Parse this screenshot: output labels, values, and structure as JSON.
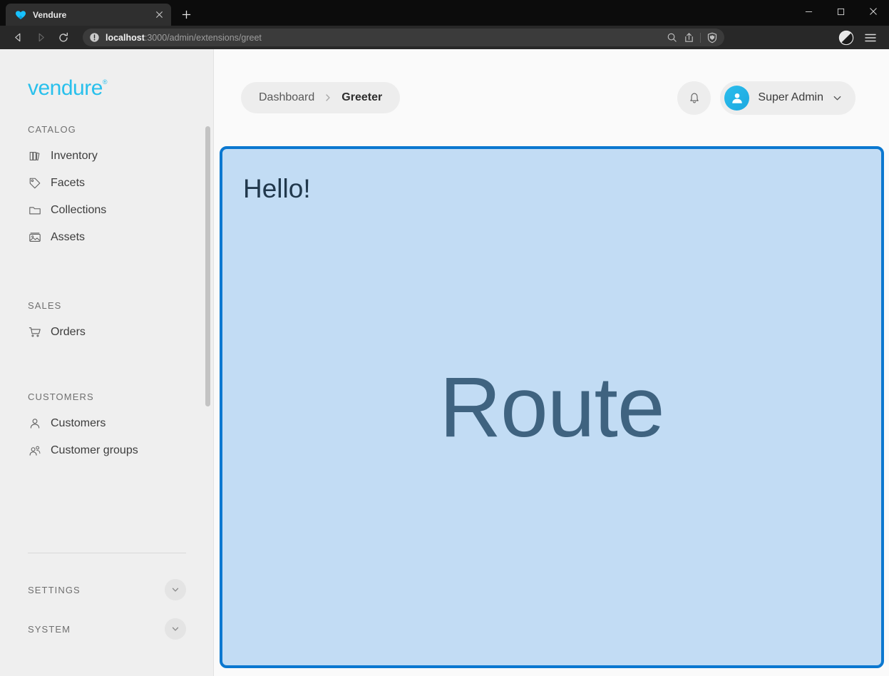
{
  "browser": {
    "tab": {
      "title": "Vendure",
      "favicon_icon": "vendure-heart-icon",
      "close_icon": "close-icon"
    },
    "new_tab_icon": "plus-icon",
    "window_controls": {
      "minimize_icon": "minimize-icon",
      "maximize_icon": "maximize-icon",
      "close_icon": "window-close-icon"
    },
    "nav": {
      "back_icon": "back-arrow-icon",
      "forward_icon": "forward-arrow-icon",
      "reload_icon": "reload-icon"
    },
    "omnibox": {
      "info_icon": "info-circle-icon",
      "url_host": "localhost",
      "url_rest": ":3000/admin/extensions/greet",
      "search_icon": "search-icon",
      "share_icon": "share-icon",
      "shield_icon": "brave-shield-icon"
    },
    "toolbar_right": {
      "rewards_icon": "brave-rewards-icon",
      "menu_icon": "hamburger-menu-icon"
    }
  },
  "sidebar": {
    "logo_text": "vendure",
    "logo_registered": "®",
    "sections": [
      {
        "title": "CATALOG",
        "items": [
          {
            "label": "Inventory",
            "icon": "inventory-icon"
          },
          {
            "label": "Facets",
            "icon": "tag-icon"
          },
          {
            "label": "Collections",
            "icon": "folder-icon"
          },
          {
            "label": "Assets",
            "icon": "image-icon"
          }
        ]
      },
      {
        "title": "SALES",
        "items": [
          {
            "label": "Orders",
            "icon": "cart-icon"
          }
        ]
      },
      {
        "title": "CUSTOMERS",
        "items": [
          {
            "label": "Customers",
            "icon": "user-icon"
          },
          {
            "label": "Customer groups",
            "icon": "users-group-icon"
          }
        ]
      }
    ],
    "collapsibles": [
      {
        "title": "SETTINGS",
        "icon": "chevron-down-icon"
      },
      {
        "title": "SYSTEM",
        "icon": "chevron-down-icon"
      }
    ]
  },
  "topbar": {
    "breadcrumb": {
      "parent": "Dashboard",
      "separator_icon": "chevron-right-icon",
      "current": "Greeter"
    },
    "notifications_icon": "bell-icon",
    "user": {
      "avatar_icon": "user-avatar-icon",
      "name": "Super Admin",
      "caret_icon": "chevron-down-icon"
    }
  },
  "content": {
    "heading": "Hello!",
    "placeholder_label": "Route"
  },
  "colors": {
    "brand_cyan": "#29c0ec",
    "panel_border_blue": "#0b78d0",
    "panel_fill_blue": "#c2dcf4",
    "route_text": "#3f6380",
    "heading_text": "#21384c",
    "sidebar_bg": "#efefef",
    "main_bg": "#fafafa"
  }
}
